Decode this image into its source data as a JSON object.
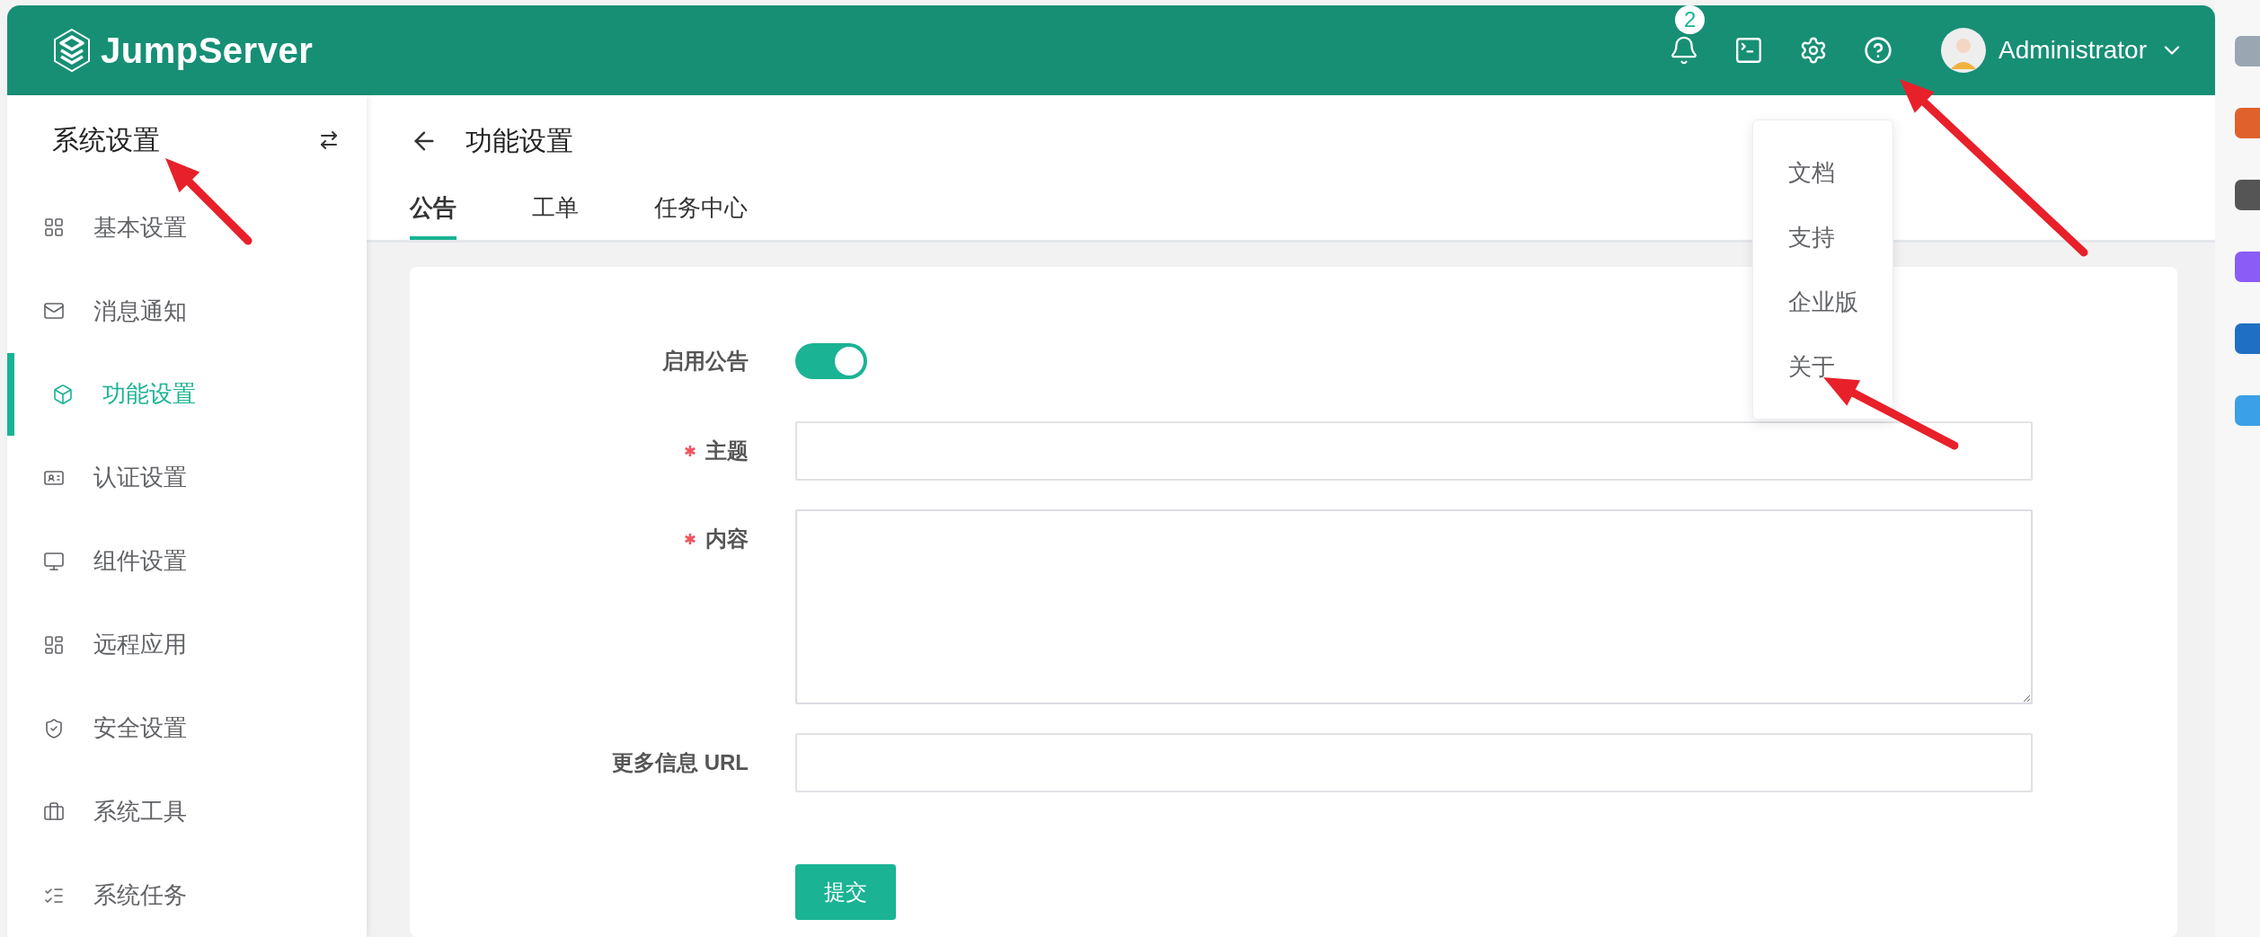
{
  "header": {
    "logo": "JumpServer",
    "notification_count": "2",
    "user": "Administrator"
  },
  "help_menu": {
    "items": [
      "文档",
      "支持",
      "企业版",
      "关于"
    ]
  },
  "sidebar": {
    "title": "系统设置",
    "items": [
      {
        "label": "基本设置",
        "selected": false
      },
      {
        "label": "消息通知",
        "selected": false
      },
      {
        "label": "功能设置",
        "selected": true
      },
      {
        "label": "认证设置",
        "selected": false
      },
      {
        "label": "组件设置",
        "selected": false
      },
      {
        "label": "远程应用",
        "selected": false
      },
      {
        "label": "安全设置",
        "selected": false
      },
      {
        "label": "系统工具",
        "selected": false
      },
      {
        "label": "系统任务",
        "selected": false
      }
    ]
  },
  "page": {
    "title": "功能设置",
    "tabs": [
      {
        "label": "公告",
        "selected": true
      },
      {
        "label": "工单",
        "selected": false
      },
      {
        "label": "任务中心",
        "selected": false
      }
    ]
  },
  "form": {
    "fields": [
      {
        "kind": "switch",
        "label": "启用公告",
        "required": false,
        "on": true
      },
      {
        "kind": "input",
        "label": "主题",
        "required": true
      },
      {
        "kind": "textarea",
        "label": "内容",
        "required": true
      },
      {
        "kind": "input",
        "label": "更多信息 URL",
        "required": false
      }
    ],
    "submit": "提交"
  }
}
